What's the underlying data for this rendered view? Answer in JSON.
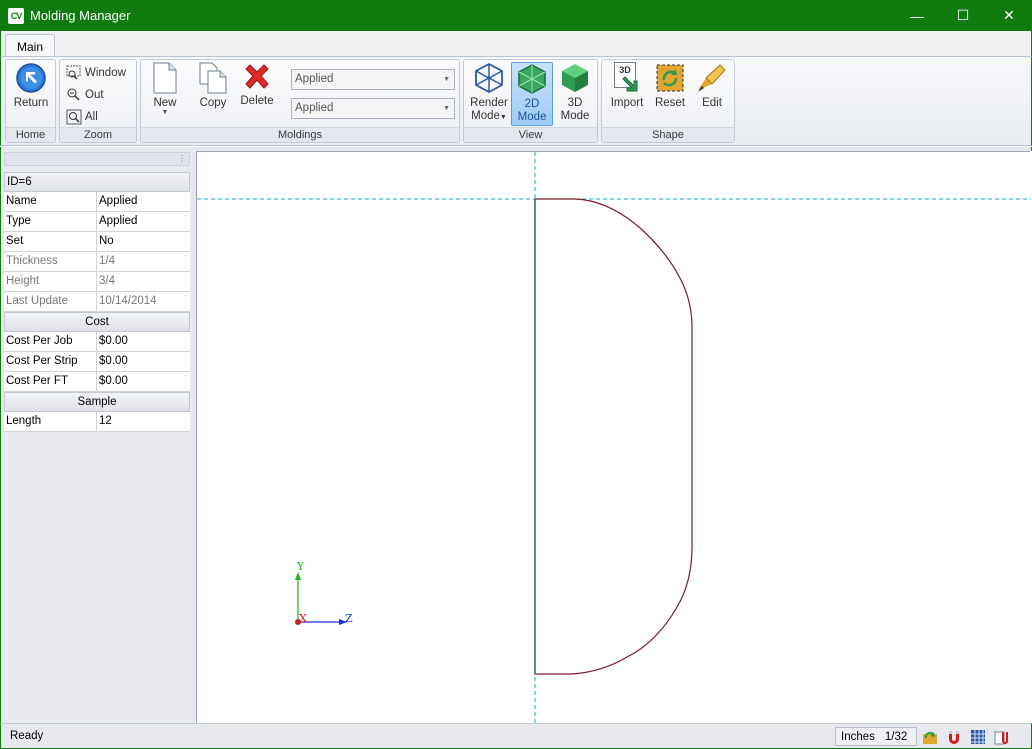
{
  "window": {
    "title": "Molding Manager",
    "app_badge": "CV",
    "minimize": "—",
    "maximize": "☐",
    "close": "✕"
  },
  "ribbon": {
    "tab": "Main",
    "groups": {
      "home": {
        "label": "Home",
        "return_label": "Return"
      },
      "zoom": {
        "label": "Zoom",
        "window": "Window",
        "out": "Out",
        "all": "All"
      },
      "moldings": {
        "label": "Moldings",
        "new": "New",
        "copy": "Copy",
        "delete": "Delete",
        "combo1": "Applied",
        "combo2": "Applied"
      },
      "view": {
        "label": "View",
        "render_mode_1": "Render",
        "render_mode_2": "Mode",
        "mode2d_1": "2D",
        "mode2d_2": "Mode",
        "mode3d_1": "3D",
        "mode3d_2": "Mode"
      },
      "shape": {
        "label": "Shape",
        "import": "Import",
        "reset": "Reset",
        "edit": "Edit",
        "import_badge": "3D"
      }
    }
  },
  "properties": {
    "id_header": "ID=6",
    "general": [
      {
        "key": "Name",
        "value": "Applied",
        "dim": false
      },
      {
        "key": "Type",
        "value": "Applied",
        "dim": false
      },
      {
        "key": "Set",
        "value": "No",
        "dim": false
      },
      {
        "key": "Thickness",
        "value": "1/4",
        "dim": true
      },
      {
        "key": "Height",
        "value": "3/4",
        "dim": true
      },
      {
        "key": "Last Update",
        "value": "10/14/2014",
        "dim": true
      }
    ],
    "cost_header": "Cost",
    "cost": [
      {
        "key": "Cost Per Job",
        "value": "$0.00"
      },
      {
        "key": "Cost Per Strip",
        "value": "$0.00"
      },
      {
        "key": "Cost Per FT",
        "value": "$0.00"
      }
    ],
    "sample_header": "Sample",
    "sample": [
      {
        "key": "Length",
        "value": "12"
      }
    ]
  },
  "axes": {
    "y": "Y",
    "x": "X",
    "z": "Z"
  },
  "status": {
    "text": "Ready",
    "units": "Inches",
    "precision": "1/32"
  },
  "colors": {
    "titlebar": "#107c10",
    "profile": "#7a1a2a",
    "guide": "#00b4c8",
    "axis_y": "#1bb31b",
    "axis_z": "#1a2fd6",
    "axis_x": "#d61a1a"
  }
}
